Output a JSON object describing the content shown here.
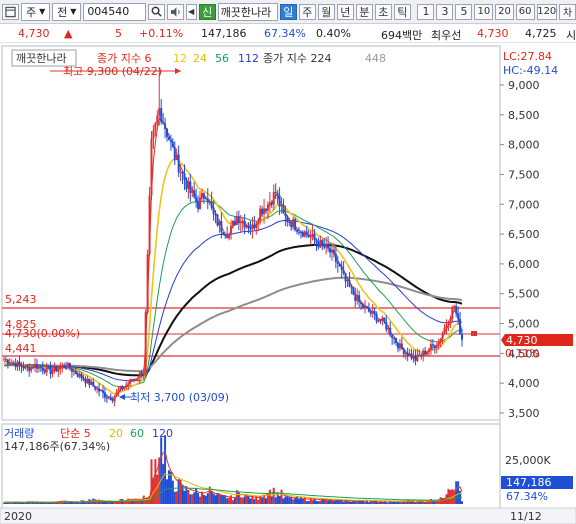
{
  "toolbar": {
    "menu_icon": "window-icon",
    "market_select": "주",
    "type_select": "전",
    "stock_code": "004540",
    "search_icon": "search-icon",
    "sound_icon": "speaker-icon",
    "badge_label": "신",
    "stock_name": "깨끗한나라",
    "period_buttons": [
      "일",
      "주",
      "월",
      "년",
      "분",
      "초",
      "틱"
    ],
    "active_period": "일",
    "number_buttons": [
      "1",
      "3",
      "5",
      "10",
      "20",
      "60",
      "120"
    ],
    "overflow_label": "차"
  },
  "info": {
    "price": "4,730",
    "change_arrow": "▲",
    "change": "5",
    "change_rate": "+0.11%",
    "volume": "147,186",
    "volume_ratio": "67.34%",
    "turnover_rate": "0.40%",
    "amount": "694백만",
    "best_ask_label": "최우선",
    "best_ask": "4,730",
    "best_bid": "4,725",
    "trailing": "시"
  },
  "price_panel": {
    "name_label": "깨끗한나라",
    "ma_label": "종가 지수 6",
    "ma_periods": [
      "12",
      "24",
      "56",
      "112"
    ],
    "ma_colors": [
      "#f0c419",
      "#f0c419",
      "#1f9d55",
      "#2a3bd0"
    ],
    "long_ma_label": "종가 지수 224",
    "long_ma_extra": "448",
    "lc_label": "LC:27.84",
    "hc_label": "HC:-49.14",
    "high_label": "최고 9,300 (04/22)",
    "low_label": "최저 3,700 (03/09)",
    "level_5243": "5,243",
    "level_4825": "4,825",
    "level_ref": "4,730(0.00%)",
    "level_4441": "4,441",
    "level_pct": "0.11%",
    "current_price_tag": "4,730"
  },
  "volume_panel": {
    "title": "거래량",
    "ma_label": "단순 5",
    "ma_periods": [
      "20",
      "60",
      "120"
    ],
    "volume_text": "147,186주(67.34%)",
    "axis_label": "25,000K",
    "current_tag": "147,186",
    "current_pct": "67.34%"
  },
  "footer": {
    "year": "2020",
    "date": "11/12"
  },
  "chart_data": {
    "type": "line",
    "title": "",
    "ylim": [
      3500,
      9000
    ],
    "y_ticks": [
      3500,
      4000,
      4500,
      5000,
      5500,
      6000,
      6500,
      7000,
      7500,
      8000,
      8500,
      9000
    ],
    "y_tick_labels": [
      "3,500",
      "4,000",
      "4,500",
      "5,000",
      "5,500",
      "6,000",
      "6,500",
      "7,000",
      "7,500",
      "8,000",
      "8,500",
      "9,000"
    ],
    "price_series": [
      4400,
      4350,
      4300,
      4250,
      4300,
      4250,
      4200,
      4250,
      4300,
      4200,
      4100,
      4000,
      3900,
      3800,
      3750,
      3900,
      4000,
      4100,
      4200,
      8000,
      8600,
      8200,
      7800,
      7500,
      7200,
      7000,
      7200,
      6800,
      6600,
      6500,
      6800,
      6700,
      6600,
      6900,
      7000,
      7200,
      6800,
      6700,
      6600,
      6500,
      6400,
      6300,
      6200,
      6000,
      5700,
      5500,
      5300,
      5200,
      5100,
      5000,
      4800,
      4600,
      4500,
      4400,
      4500,
      4600,
      4700,
      5000,
      5300,
      4730
    ],
    "horizontal_levels": [
      5243,
      4825,
      4441
    ],
    "volume_axis": [
      0,
      25000
    ],
    "volume_series": [
      800,
      900,
      700,
      1200,
      900,
      800,
      1000,
      1500,
      1100,
      900,
      1300,
      2000,
      1600,
      1400,
      1200,
      1800,
      2500,
      2200,
      3000,
      20000,
      28000,
      12000,
      9000,
      7000,
      6000,
      5000,
      6500,
      4000,
      3500,
      3000,
      5000,
      3500,
      3000,
      4500,
      6000,
      5000,
      3000,
      2800,
      2500,
      2300,
      2200,
      2000,
      1800,
      1700,
      1600,
      1500,
      1800,
      1500,
      1400,
      1300,
      1200,
      1400,
      1600,
      1300,
      1500,
      2000,
      2500,
      6000,
      9000,
      1472
    ]
  }
}
